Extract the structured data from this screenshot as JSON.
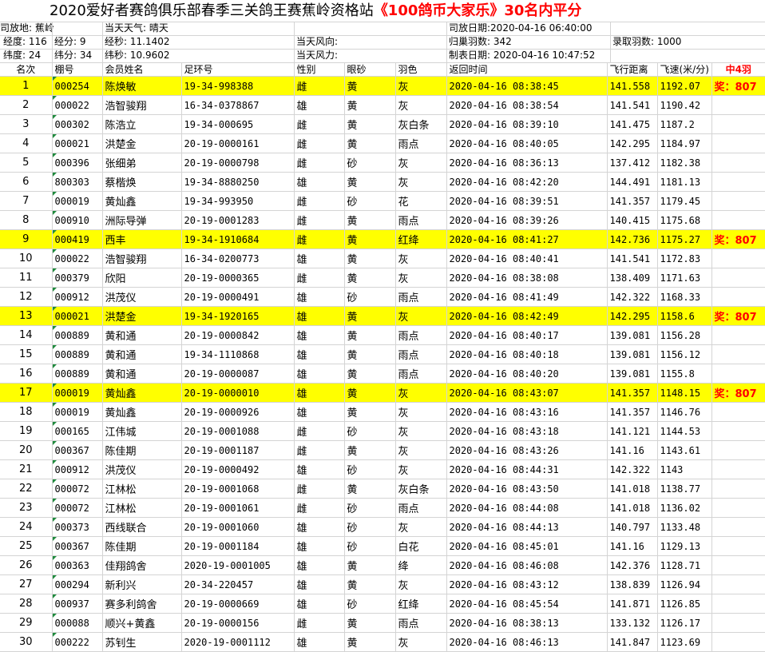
{
  "title": {
    "main": "2020爱好者赛鸽俱乐部春季三关鸽王赛蕉岭资格站",
    "red": "《100鸽币大家乐》30名内平分"
  },
  "info": {
    "r1": [
      "司放地: 蕉岭",
      "当天天气: 晴天",
      "司放日期:2020-04-16 06:40:00"
    ],
    "r2": [
      "经度: 116",
      "经分: 9",
      "经秒: 11.1402",
      "当天风向:",
      "归巢羽数: 342",
      "录取羽数: 1000"
    ],
    "r3": [
      "纬度:  24",
      "纬分: 34",
      "纬秒: 10.9602",
      "当天风力:",
      "制表日期: 2020-04-16 10:47:52"
    ]
  },
  "headers": [
    "名次",
    "棚号",
    "会员姓名",
    "足环号",
    "性别",
    "眼砂",
    "羽色",
    "返回时间",
    "飞行距离",
    "飞速(米/分)",
    "中4羽"
  ],
  "rows": [
    [
      "1",
      "000254",
      "陈焕敏",
      "19-34-998388",
      "雌",
      "黄",
      "灰",
      "2020-04-16  08:38:45",
      "141.558",
      "1192.07",
      "奖：807"
    ],
    [
      "2",
      "000022",
      "浩智骏翔",
      "16-34-0378867",
      "雄",
      "黄",
      "灰",
      "2020-04-16  08:38:54",
      "141.541",
      "1190.42",
      ""
    ],
    [
      "3",
      "000302",
      "陈浩立",
      "19-34-000695",
      "雌",
      "黄",
      "灰白条",
      "2020-04-16  08:39:10",
      "141.475",
      "1187.2",
      ""
    ],
    [
      "4",
      "000021",
      "洪楚金",
      "20-19-0000161",
      "雌",
      "黄",
      "雨点",
      "2020-04-16  08:40:05",
      "142.295",
      "1184.97",
      ""
    ],
    [
      "5",
      "000396",
      "张细弟",
      "20-19-0000798",
      "雌",
      "砂",
      "灰",
      "2020-04-16  08:36:13",
      "137.412",
      "1182.38",
      ""
    ],
    [
      "6",
      "800303",
      "蔡楷焕",
      "19-34-8880250",
      "雄",
      "黄",
      "灰",
      "2020-04-16  08:42:20",
      "144.491",
      "1181.13",
      ""
    ],
    [
      "7",
      "000019",
      "黄灿鑫",
      "19-34-993950",
      "雌",
      "砂",
      "花",
      "2020-04-16  08:39:51",
      "141.357",
      "1179.45",
      ""
    ],
    [
      "8",
      "000910",
      "洲际导弹",
      "20-19-0001283",
      "雌",
      "黄",
      "雨点",
      "2020-04-16  08:39:26",
      "140.415",
      "1175.68",
      ""
    ],
    [
      "9",
      "000419",
      "西丰",
      "19-34-1910684",
      "雌",
      "黄",
      "红绛",
      "2020-04-16  08:41:27",
      "142.736",
      "1175.27",
      "奖：807"
    ],
    [
      "10",
      "000022",
      "浩智骏翔",
      "16-34-0200773",
      "雄",
      "黄",
      "灰",
      "2020-04-16  08:40:41",
      "141.541",
      "1172.83",
      ""
    ],
    [
      "11",
      "000379",
      "欣阳",
      "20-19-0000365",
      "雌",
      "黄",
      "灰",
      "2020-04-16  08:38:08",
      "138.409",
      "1171.63",
      ""
    ],
    [
      "12",
      "000912",
      "洪茂仪",
      "20-19-0000491",
      "雄",
      "砂",
      "雨点",
      "2020-04-16  08:41:49",
      "142.322",
      "1168.33",
      ""
    ],
    [
      "13",
      "000021",
      "洪楚金",
      "19-34-1920165",
      "雄",
      "黄",
      "灰",
      "2020-04-16  08:42:49",
      "142.295",
      "1158.6",
      "奖：807"
    ],
    [
      "14",
      "000889",
      "黄和通",
      "20-19-0000842",
      "雄",
      "黄",
      "雨点",
      "2020-04-16  08:40:17",
      "139.081",
      "1156.28",
      ""
    ],
    [
      "15",
      "000889",
      "黄和通",
      "19-34-1110868",
      "雄",
      "黄",
      "雨点",
      "2020-04-16  08:40:18",
      "139.081",
      "1156.12",
      ""
    ],
    [
      "16",
      "000889",
      "黄和通",
      "20-19-0000087",
      "雄",
      "黄",
      "雨点",
      "2020-04-16  08:40:20",
      "139.081",
      "1155.8",
      ""
    ],
    [
      "17",
      "000019",
      "黄灿鑫",
      "20-19-0000010",
      "雄",
      "黄",
      "灰",
      "2020-04-16  08:43:07",
      "141.357",
      "1148.15",
      "奖：807"
    ],
    [
      "18",
      "000019",
      "黄灿鑫",
      "20-19-0000926",
      "雄",
      "黄",
      "灰",
      "2020-04-16  08:43:16",
      "141.357",
      "1146.76",
      ""
    ],
    [
      "19",
      "000165",
      "江伟城",
      "20-19-0001088",
      "雌",
      "砂",
      "灰",
      "2020-04-16  08:43:18",
      "141.121",
      "1144.53",
      ""
    ],
    [
      "20",
      "000367",
      "陈佳期",
      "20-19-0001187",
      "雌",
      "黄",
      "灰",
      "2020-04-16  08:43:26",
      "141.16",
      "1143.61",
      ""
    ],
    [
      "21",
      "000912",
      "洪茂仪",
      "20-19-0000492",
      "雄",
      "砂",
      "灰",
      "2020-04-16  08:44:31",
      "142.322",
      "1143",
      ""
    ],
    [
      "22",
      "000072",
      "江林松",
      "20-19-0001068",
      "雌",
      "黄",
      "灰白条",
      "2020-04-16  08:43:50",
      "141.018",
      "1138.77",
      ""
    ],
    [
      "23",
      "000072",
      "江林松",
      "20-19-0001061",
      "雌",
      "砂",
      "雨点",
      "2020-04-16  08:44:08",
      "141.018",
      "1136.02",
      ""
    ],
    [
      "24",
      "000373",
      "西线联合",
      "20-19-0001060",
      "雄",
      "砂",
      "灰",
      "2020-04-16  08:44:13",
      "140.797",
      "1133.48",
      ""
    ],
    [
      "25",
      "000367",
      "陈佳期",
      "20-19-0001184",
      "雄",
      "砂",
      "白花",
      "2020-04-16  08:45:01",
      "141.16",
      "1129.13",
      ""
    ],
    [
      "26",
      "000363",
      "佳翔鸽舍",
      "2020-19-0001005",
      "雄",
      "黄",
      "绛",
      "2020-04-16  08:46:08",
      "142.376",
      "1128.71",
      ""
    ],
    [
      "27",
      "000294",
      "新利兴",
      "20-34-220457",
      "雄",
      "黄",
      "灰",
      "2020-04-16  08:43:12",
      "138.839",
      "1126.94",
      ""
    ],
    [
      "28",
      "000937",
      "赛多利鸽舍",
      "20-19-0000669",
      "雄",
      "砂",
      "红绛",
      "2020-04-16  08:45:54",
      "141.871",
      "1126.85",
      ""
    ],
    [
      "29",
      "000088",
      "顺兴+黄鑫",
      "20-19-0000156",
      "雌",
      "黄",
      "雨点",
      "2020-04-16  08:38:13",
      "133.132",
      "1126.17",
      ""
    ],
    [
      "30",
      "000222",
      "苏钊生",
      "2020-19-0001112",
      "雄",
      "黄",
      "灰",
      "2020-04-16  08:46:13",
      "141.847",
      "1123.69",
      ""
    ]
  ],
  "highlighted_ranks": [
    "1",
    "9",
    "13",
    "17"
  ],
  "colors": {
    "highlight": "#ffff00",
    "prize_text": "#ff0000",
    "grid": "#d4d4d4",
    "cell_marker": "#1e8a3c"
  }
}
